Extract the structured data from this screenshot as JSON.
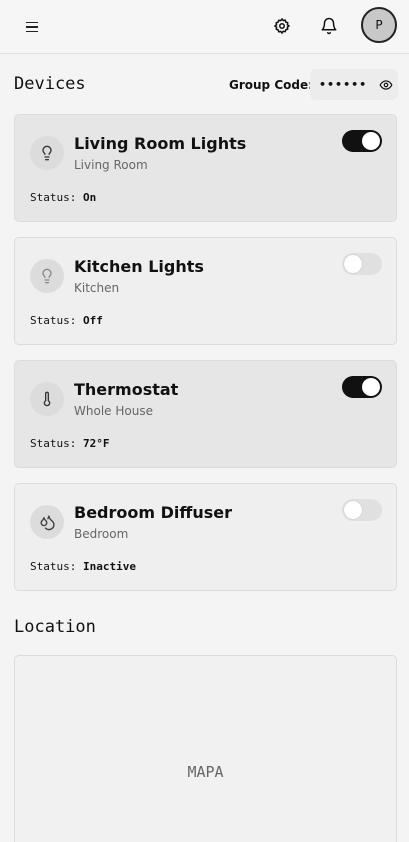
{
  "header": {
    "avatar_initial": "P"
  },
  "devices": {
    "title": "Devices",
    "group_code_label": "Group Code:",
    "group_code_value": "••••••",
    "status_label": "Status:",
    "items": [
      {
        "name": "Living Room Lights",
        "location": "Living Room",
        "status": "On",
        "enabled": true,
        "icon": "lightbulb-icon"
      },
      {
        "name": "Kitchen Lights",
        "location": "Kitchen",
        "status": "Off",
        "enabled": false,
        "icon": "lightbulb-icon"
      },
      {
        "name": "Thermostat",
        "location": "Whole House",
        "status": "72°F",
        "enabled": true,
        "icon": "thermometer-icon"
      },
      {
        "name": "Bedroom Diffuser",
        "location": "Bedroom",
        "status": "Inactive",
        "enabled": false,
        "icon": "droplets-icon"
      }
    ]
  },
  "location": {
    "title": "Location",
    "map_placeholder": "MAPA"
  },
  "colors": {
    "toggle_on": "#111111",
    "toggle_off": "#e0e0e0",
    "background": "#f4f4f4"
  }
}
